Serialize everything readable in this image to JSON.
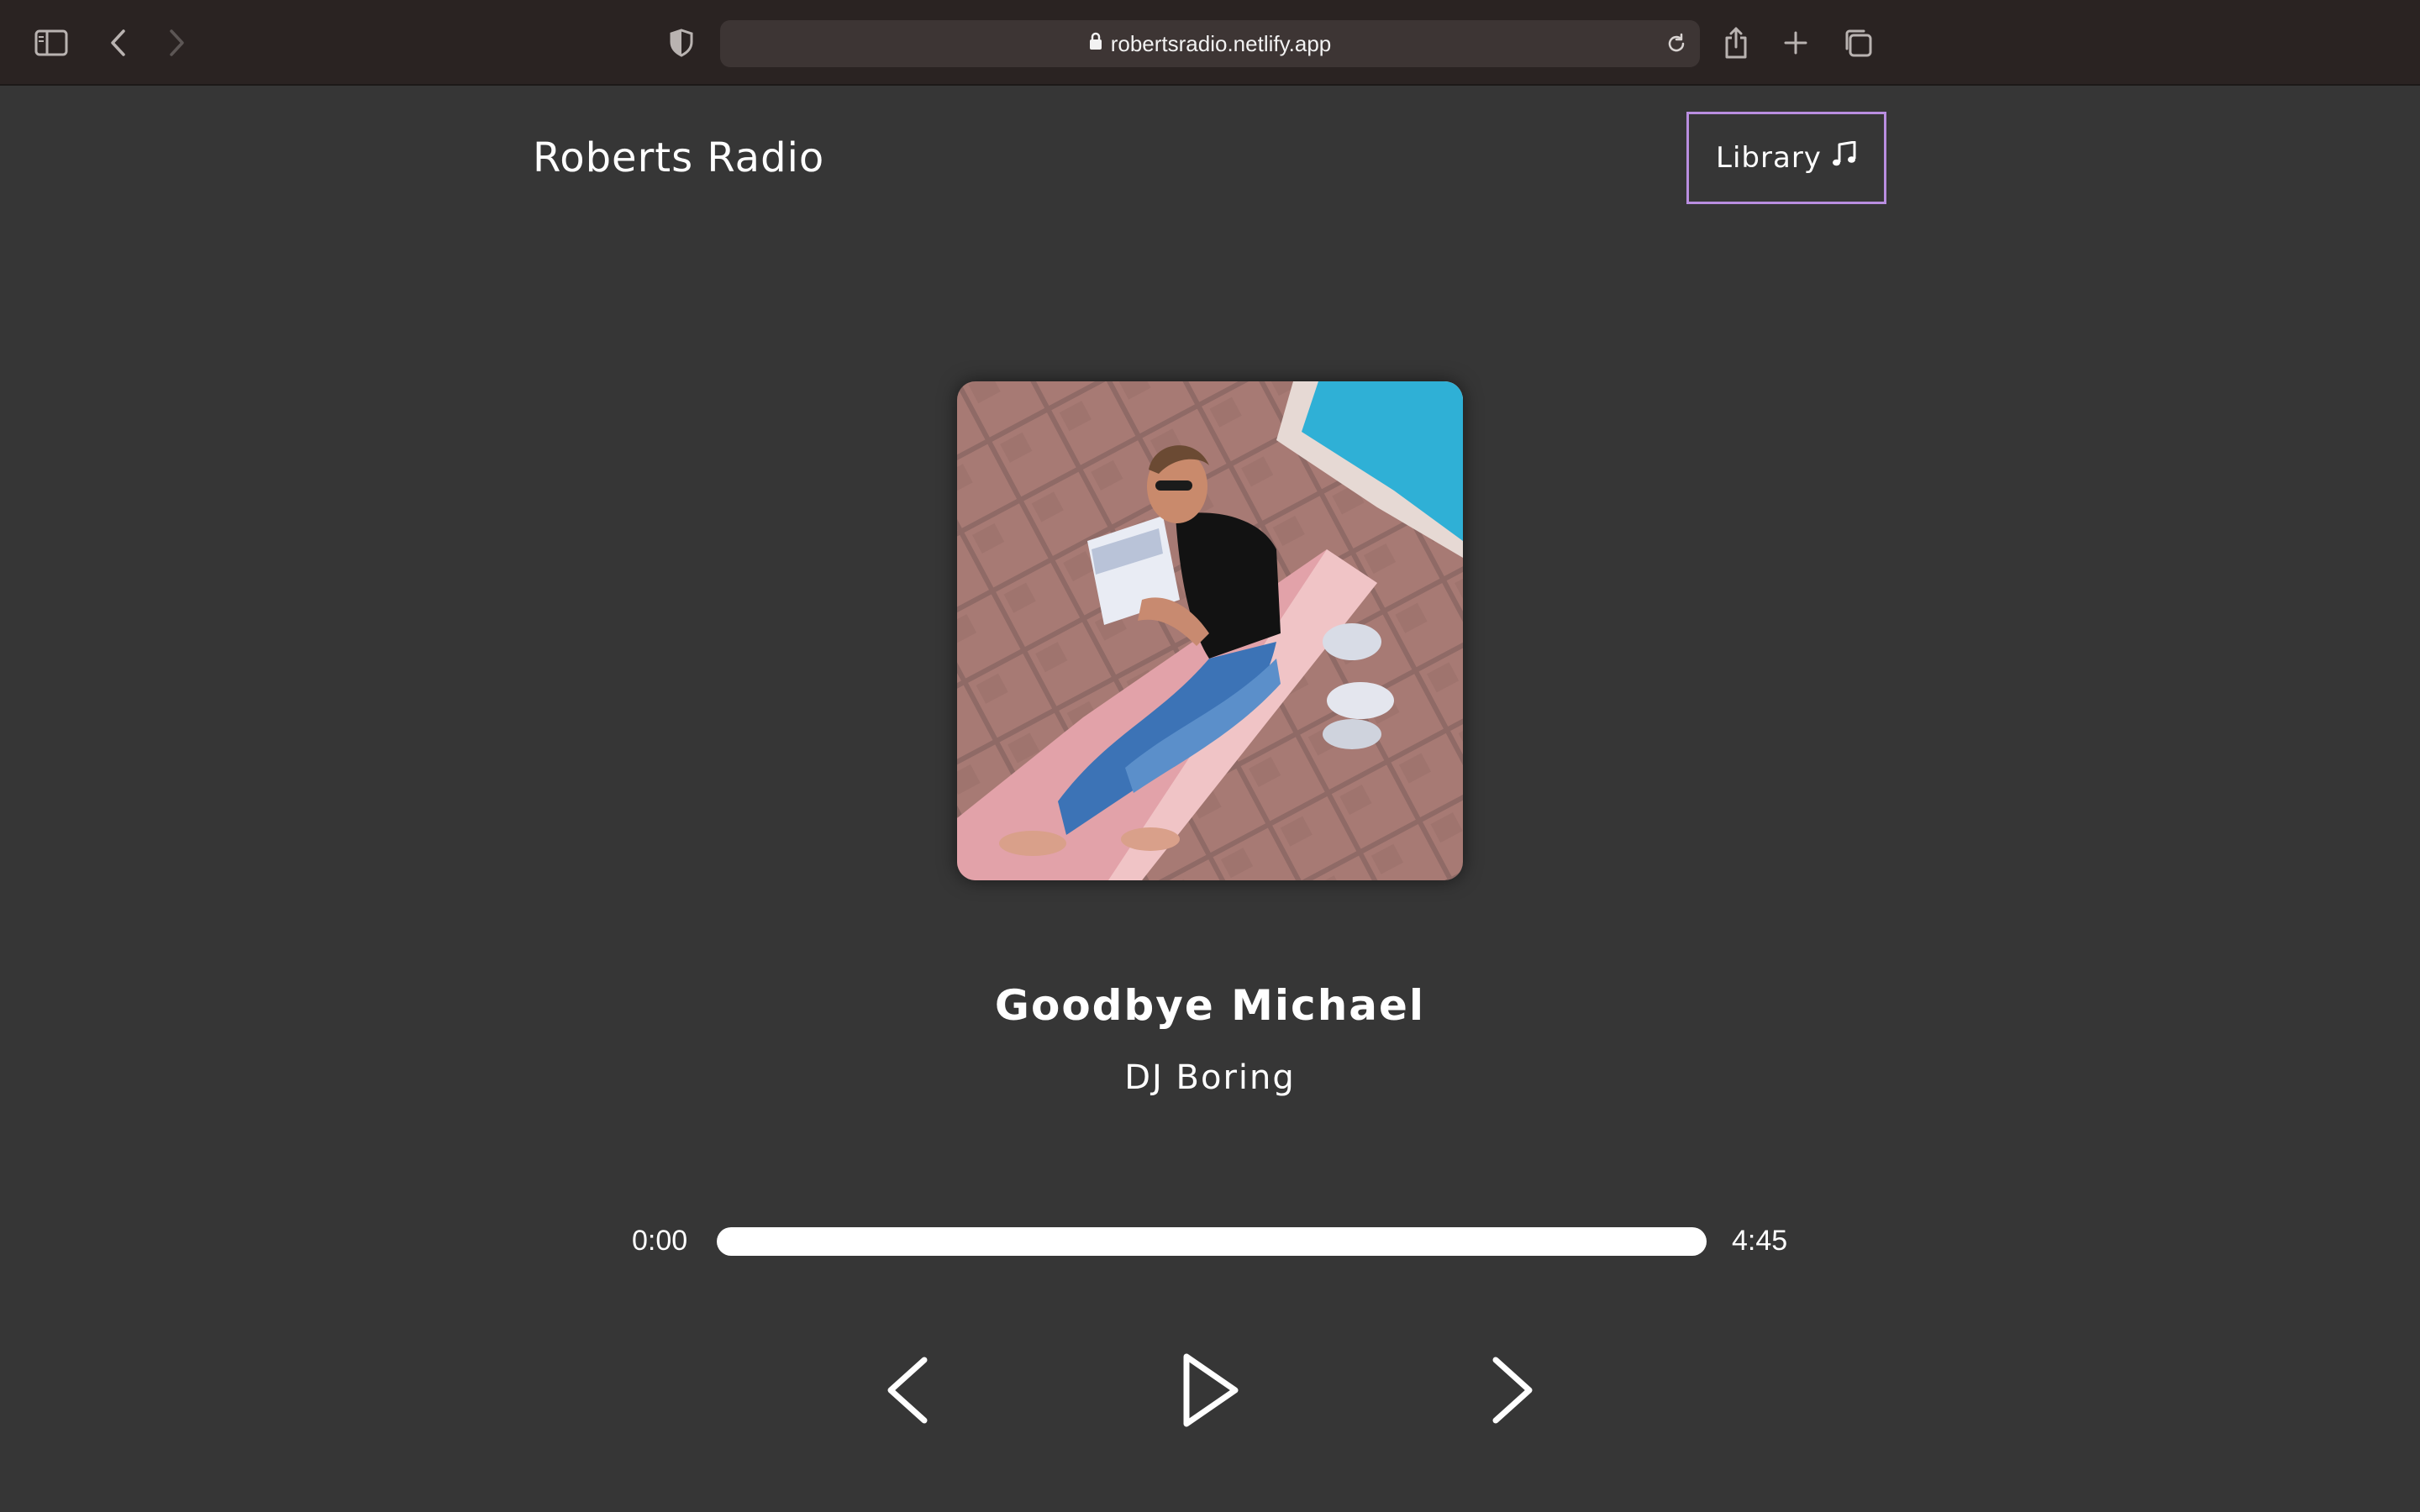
{
  "browser": {
    "url": "robertsradio.netlify.app",
    "icons": {
      "sidebar": "sidebar-icon",
      "back": "chevron-left-icon",
      "forward": "chevron-right-icon",
      "privacy": "shield-icon",
      "lock": "lock-icon",
      "reload": "reload-icon",
      "share": "share-icon",
      "new_tab": "plus-icon",
      "tabs": "tab-overview-icon"
    }
  },
  "header": {
    "title": "Roberts Radio",
    "library_label": "Library",
    "library_icon": "music-note-icon",
    "library_border_color": "#b98ee0"
  },
  "player": {
    "song_title": "Goodbye Michael",
    "artist": "DJ Boring",
    "current_time": "0:00",
    "duration": "4:45",
    "progress": 0,
    "controls": {
      "prev_icon": "skip-back-icon",
      "play_icon": "play-icon",
      "next_icon": "skip-forward-icon"
    }
  },
  "colors": {
    "background": "#363636",
    "toolbar": "#2a2322",
    "accent": "#b98ee0",
    "text": "#ffffff"
  }
}
